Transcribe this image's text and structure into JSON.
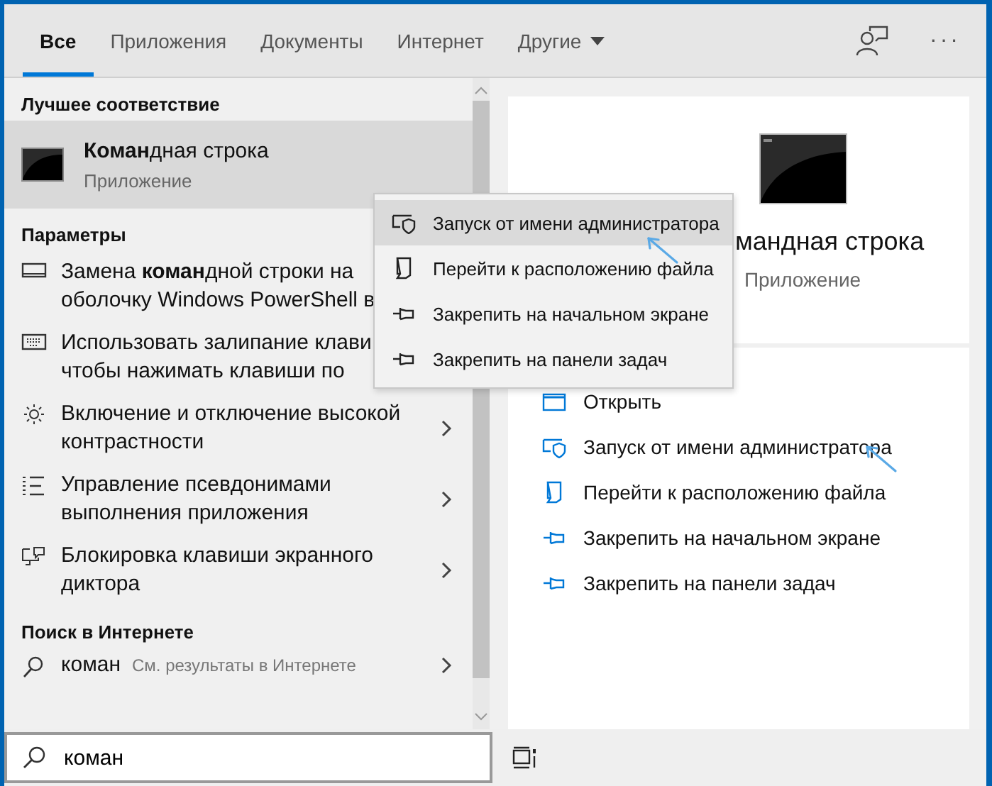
{
  "tabs": [
    {
      "label": "Все",
      "selected": true
    },
    {
      "label": "Приложения",
      "selected": false
    },
    {
      "label": "Документы",
      "selected": false
    },
    {
      "label": "Интернет",
      "selected": false
    },
    {
      "label": "Другие",
      "selected": false,
      "kind": "dropdown"
    }
  ],
  "toolbar": {
    "more": "···"
  },
  "results": {
    "best_match_header": "Лучшее соответствие",
    "best_match": {
      "title": "**Коман**дная строка",
      "subtitle": "Приложение",
      "selected": true
    },
    "settings_header": "Параметры",
    "settings": [
      {
        "lines": [
          "Замена **коман**дной строки на",
          "оболочку Windows PowerShell в"
        ],
        "chevron": false
      },
      {
        "lines": [
          "Использовать залипание клави",
          "чтобы нажимать клавиши по"
        ],
        "chevron": false
      },
      {
        "lines": [
          "Включение и отключение высокой",
          "контрастности"
        ],
        "chevron": true
      },
      {
        "lines": [
          "Управление псевдонимами",
          "выполнения приложения"
        ],
        "chevron": true
      },
      {
        "lines": [
          "Блокировка клавиши экранного",
          "диктора"
        ],
        "chevron": true
      }
    ],
    "web_header": "Поиск в Интернете",
    "web": {
      "query": "коман",
      "hint": "См. результаты в Интернете",
      "chevron": true
    }
  },
  "context_menu": [
    {
      "label": "Запуск от имени администратора",
      "highlighted": true
    },
    {
      "label": "Перейти к расположению файла",
      "highlighted": false
    },
    {
      "label": "Закрепить на начальном экране",
      "highlighted": false
    },
    {
      "label": "Закрепить на панели задач",
      "highlighted": false
    }
  ],
  "detail": {
    "title": "мандная строка",
    "subtitle": "Приложение",
    "actions": [
      "Открыть",
      "Запуск от имени администратора",
      "Перейти к расположению файла",
      "Закрепить на начальном экране",
      "Закрепить на панели задач"
    ]
  },
  "search": {
    "value": "коман"
  }
}
